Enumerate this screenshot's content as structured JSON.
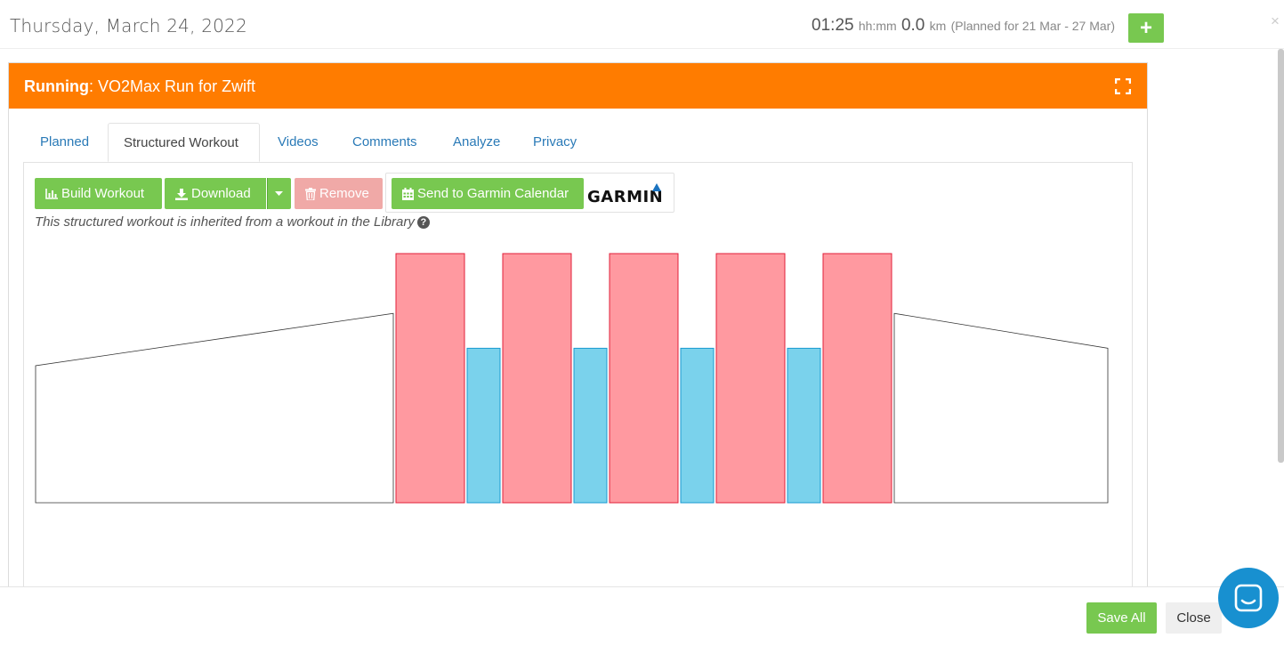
{
  "header": {
    "date": "Thursday, March 24, 2022",
    "duration": "01:25",
    "duration_unit": "hh:mm",
    "distance": "0.0",
    "distance_unit": "km",
    "planned_range": "(Planned for 21 Mar - 27 Mar)",
    "add_label": "+",
    "close_label": "×"
  },
  "panel": {
    "sport": "Running",
    "separator": ":",
    "title": "VO2Max Run for Zwift",
    "header_color": "#ff7c00"
  },
  "tabs": [
    {
      "label": "Planned"
    },
    {
      "label": "Structured Workout",
      "active": true
    },
    {
      "label": "Videos"
    },
    {
      "label": "Comments"
    },
    {
      "label": "Analyze"
    },
    {
      "label": "Privacy"
    }
  ],
  "toolbar": {
    "build_label": "Build Workout",
    "build_icon": "bar-chart-icon",
    "download_label": "Download",
    "download_icon": "download-icon",
    "dropdown_icon": "caret-down-icon",
    "remove_label": "Remove",
    "remove_icon": "trash-icon",
    "garmin_label": "Send to Garmin Calendar",
    "garmin_icon": "calendar-icon",
    "garmin_logo": "GARMIN",
    "green": "#78c850",
    "pink": "#f0a9a7"
  },
  "note": "This structured workout is inherited from a workout in the Library",
  "workout": {
    "colors": {
      "warmup": "#ffffff",
      "interval": "#ff99a0",
      "interval_border": "#e0203a",
      "recovery": "#7ad2ec",
      "recovery_border": "#1a9ad0"
    },
    "steps": [
      {
        "type": "warmup",
        "start": 0.55,
        "end": 0.76
      },
      {
        "type": "interval",
        "intensity": 1.0
      },
      {
        "type": "recovery",
        "intensity": 0.62
      },
      {
        "type": "interval",
        "intensity": 1.0
      },
      {
        "type": "recovery",
        "intensity": 0.62
      },
      {
        "type": "interval",
        "intensity": 1.0
      },
      {
        "type": "recovery",
        "intensity": 0.62
      },
      {
        "type": "interval",
        "intensity": 1.0
      },
      {
        "type": "recovery",
        "intensity": 0.62
      },
      {
        "type": "interval",
        "intensity": 1.0
      },
      {
        "type": "cooldown",
        "start": 0.76,
        "end": 0.62
      }
    ]
  },
  "footer": {
    "save_label": "Save All",
    "close_label": "Close",
    "chat_icon": "chat-icon"
  }
}
